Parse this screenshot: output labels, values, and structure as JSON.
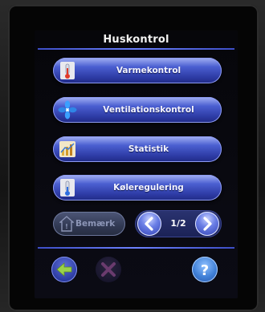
{
  "screen": {
    "title": "Huskontrol"
  },
  "menu": {
    "items": [
      {
        "label": "Varmekontrol",
        "icon": "thermometer-icon"
      },
      {
        "label": "Ventilationskontrol",
        "icon": "fan-icon"
      },
      {
        "label": "Statistik",
        "icon": "chart-icon"
      },
      {
        "label": "Køleregulering",
        "icon": "thermometer-icon"
      }
    ]
  },
  "bemaerk": {
    "label": "Bemærk",
    "icon": "house-icon",
    "state": "disabled"
  },
  "pager": {
    "label": "1/2",
    "prev_icon": "chevron-left-icon",
    "next_icon": "chevron-right-icon"
  },
  "bottom": {
    "back_icon": "arrow-left-icon",
    "close_icon": "close-icon",
    "help_icon": "help-icon"
  },
  "colors": {
    "accent": "#4b5fd1",
    "back_arrow": "#9ad24a",
    "close_disabled": "#6a3b6e",
    "help": "#3f7fd6"
  }
}
